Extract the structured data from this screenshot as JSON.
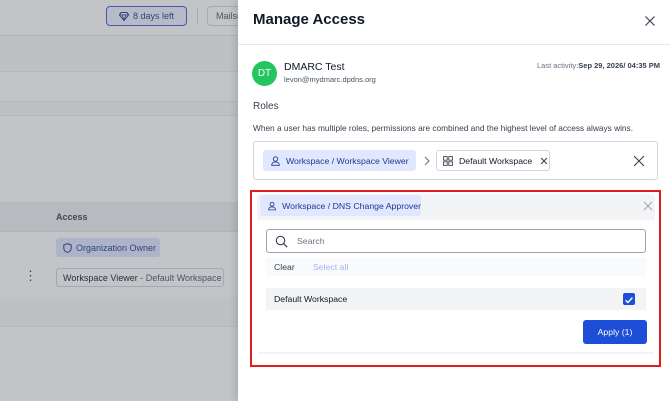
{
  "background": {
    "trial_badge": "8 days left",
    "mail_chip": "Mailse",
    "table_header_access": "Access",
    "org_owner_badge": "Organization Owner",
    "workspace_role": "Workspace Viewer",
    "workspace_sep": " - ",
    "workspace_name": "Default Workspace"
  },
  "modal": {
    "title": "Manage Access",
    "user": {
      "initials": "DT",
      "avatar_color": "#22c55e",
      "name": "DMARC Test",
      "email": "levon@mydmarc.dpdns.org",
      "last_activity_label": "Last activity:",
      "last_activity_date": "Sep 29, 2026",
      "last_activity_time": "/ 04:35 PM"
    },
    "roles_heading": "Roles",
    "roles_note": "When a user has multiple roles, permissions are combined and the highest level of access always wins.",
    "existing_role": {
      "role": "Workspace / Workspace Viewer",
      "workspace": "Default Workspace"
    },
    "editor": {
      "role": "Workspace / DNS Change Approver",
      "search_placeholder": "Search",
      "clear_label": "Clear",
      "select_all_label": "Select all",
      "options": [
        {
          "label": "Default Workspace",
          "checked": true
        }
      ],
      "apply_label": "Apply (1)"
    }
  },
  "colors": {
    "accent": "#1d4ed8",
    "chip_bg": "#e0e7ff",
    "highlight_border": "#e11d1d"
  }
}
